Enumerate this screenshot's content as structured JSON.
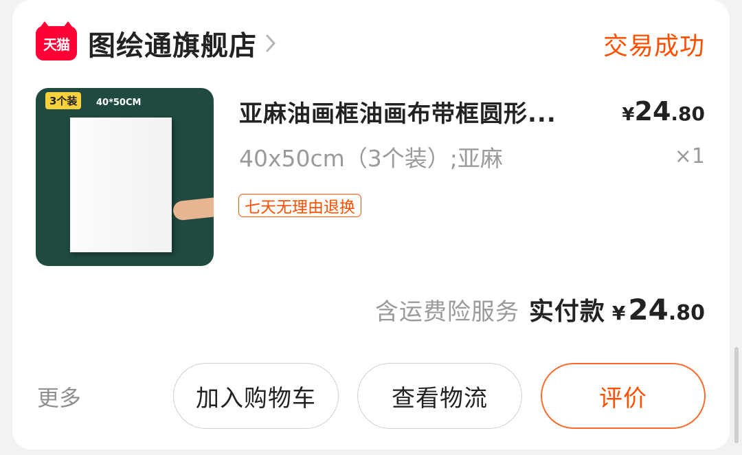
{
  "store": {
    "logo_text": "天猫",
    "name": "图绘通旗舰店",
    "status": "交易成功"
  },
  "product": {
    "thumb_badge": "3个装",
    "thumb_size": "40*50CM",
    "title": "亚麻油画框油画布带框圆形...",
    "price_symbol": "¥",
    "price_int": "24",
    "price_dec": ".80",
    "sku": "40x50cm（3个装）;亚麻",
    "quantity": "×1",
    "tag": "七天无理由退换"
  },
  "total": {
    "note": "含运费险服务",
    "label": "实付款",
    "symbol": "¥",
    "int": "24",
    "dec": ".80"
  },
  "actions": {
    "more": "更多",
    "add_to_cart": "加入购物车",
    "view_logistics": "查看物流",
    "review": "评价"
  },
  "colors": {
    "accent": "#ff5000",
    "tmall_red": "#ff0036"
  }
}
